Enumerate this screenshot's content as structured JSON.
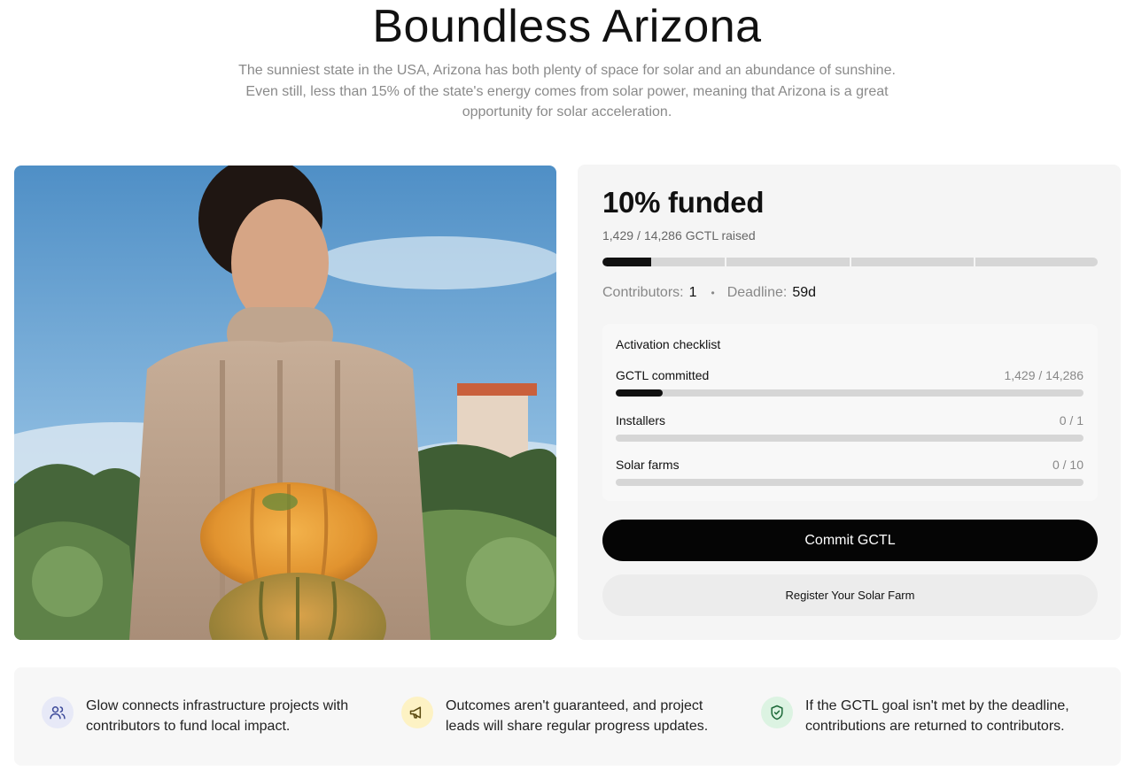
{
  "hero": {
    "title": "Boundless Arizona",
    "description": "The sunniest state in the USA, Arizona has both plenty of space for solar and an abundance of sunshine. Even still, less than 15% of the state's energy comes from solar power, meaning that Arizona is a great opportunity for solar acceleration."
  },
  "photo": {
    "icon": "photo-woman-with-pumpkins"
  },
  "funding": {
    "title": "10% funded",
    "raised_amount": "1,429",
    "raised_sep": "/",
    "raised_goal": "14,286",
    "raised_suffix": "GCTL raised",
    "progress_fraction": 0.1,
    "progress_segments": 4,
    "contributors_label": "Contributors:",
    "contributors_value": "1",
    "separator": "•",
    "deadline_label": "Deadline:",
    "deadline_value": "59d"
  },
  "checklist": {
    "title": "Activation checklist",
    "items": [
      {
        "label": "GCTL committed",
        "count": "1,429 / 14,286",
        "fraction": 0.1
      },
      {
        "label": "Installers",
        "count": "0 / 1",
        "fraction": 0
      },
      {
        "label": "Solar farms",
        "count": "0 / 10",
        "fraction": 0
      }
    ]
  },
  "actions": {
    "commit_label": "Commit GCTL",
    "register_label": "Register Your Solar Farm"
  },
  "info": [
    {
      "icon": "users-icon",
      "text": "Glow connects infrastructure projects with contributors to fund local impact."
    },
    {
      "icon": "megaphone-icon",
      "text": "Outcomes aren't guaranteed, and project leads will share regular progress updates."
    },
    {
      "icon": "shield-check-icon",
      "text": "If the GCTL goal isn't met by the deadline, contributions are returned to contributors."
    }
  ],
  "colors": {
    "text": "#111111",
    "muted": "#888888",
    "card_bg": "#f5f5f5",
    "primary_button": "#050505",
    "users_icon_bg": "#e7e9f7",
    "megaphone_icon_bg": "#fdf2c4",
    "shield_icon_bg": "#dcf3e2"
  }
}
